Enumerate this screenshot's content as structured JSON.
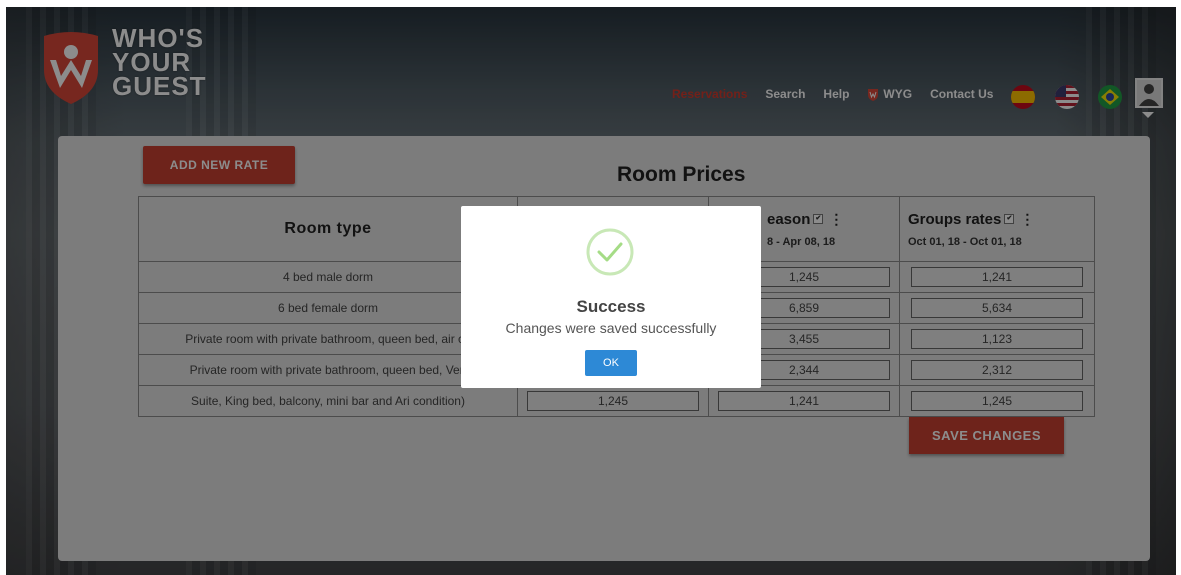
{
  "brand": {
    "logo_lines": [
      "WHO'S",
      "YOUR",
      "GUEST"
    ]
  },
  "nav": {
    "items": [
      "Reservations",
      "Search",
      "Help",
      "WYG",
      "Contact Us"
    ],
    "active": "Reservations"
  },
  "flags": [
    "spain-flag",
    "usa-flag",
    "brazil-flag"
  ],
  "page": {
    "add_button": "ADD NEW RATE",
    "title": "Room Prices",
    "save_button": "SAVE CHANGES"
  },
  "table": {
    "room_header": "Room type",
    "columns": [
      {
        "name": "",
        "dates": ""
      },
      {
        "name": "eason",
        "dates": "8 - Apr 08, 18"
      },
      {
        "name": "Groups rates",
        "dates": "Oct 01, 18 - Oct 01, 18"
      }
    ],
    "rows": [
      {
        "room": "4 bed male dorm",
        "values": [
          "",
          "1,245",
          "1,241"
        ]
      },
      {
        "room": "6 bed female dorm",
        "values": [
          "",
          "6,859",
          "5,634"
        ]
      },
      {
        "room": "Private room with private bathroom, queen bed, air co",
        "values": [
          "",
          "3,455",
          "1,123"
        ]
      },
      {
        "room": "Private room with private bathroom, queen bed, Ven",
        "values": [
          "",
          "2,344",
          "2,312"
        ]
      },
      {
        "room": "Suite, King bed, balcony, mini bar and Ari condition)",
        "values": [
          "1,245",
          "1,241",
          "1,245"
        ]
      }
    ]
  },
  "modal": {
    "title": "Success",
    "message": "Changes were saved successfully",
    "ok_label": "OK"
  },
  "colors": {
    "accent_red": "#c94132",
    "ok_blue": "#2d89d6",
    "success_green": "#a5dc86"
  }
}
